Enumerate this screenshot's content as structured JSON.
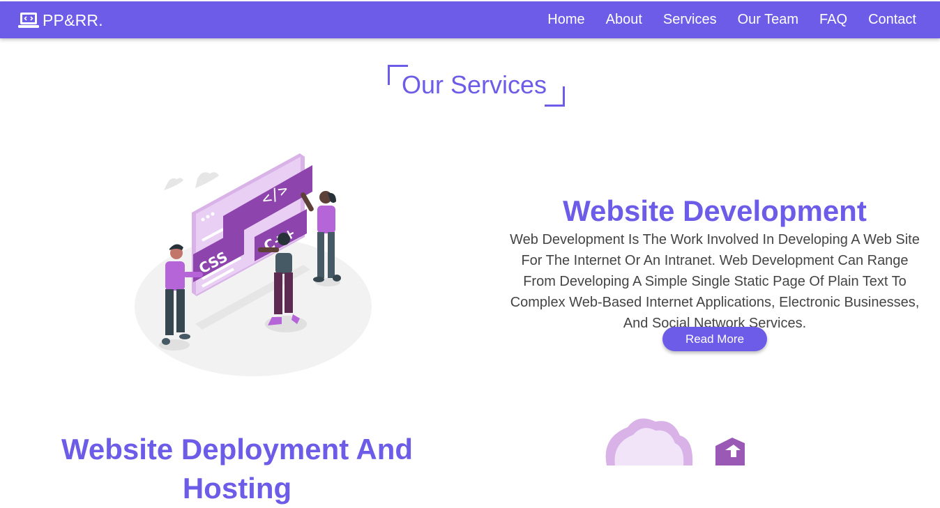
{
  "navbar": {
    "brand": "PP&RR.",
    "brand_icon": "laptop-code-icon",
    "links": [
      "Home",
      "About",
      "Services",
      "Our Team",
      "FAQ",
      "Contact"
    ]
  },
  "section": {
    "title": "Our Services"
  },
  "services": [
    {
      "heading": "Website Development",
      "description": "Web Development Is The Work Involved In Developing A Web Site For The Internet Or An Intranet. Web Development Can Range From Developing A Simple Single Static Page Of Plain Text To Complex Web-Based Internet Applications, Electronic Businesses, And Social Network Services.",
      "button": "Read More",
      "illustration_labels": [
        "</>",
        "CSS",
        "C++"
      ]
    },
    {
      "heading": "Website Deployment And Hosting"
    }
  ],
  "colors": {
    "accent": "#6c5ce7",
    "text": "#444444",
    "illustration_purple": "#8e44ad"
  }
}
